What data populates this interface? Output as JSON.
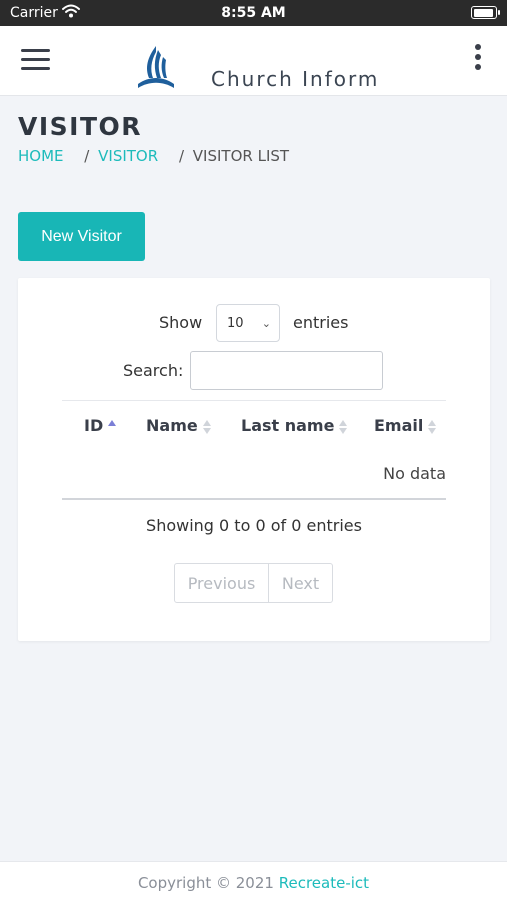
{
  "status_bar": {
    "carrier": "Carrier",
    "time": "8:55 AM",
    "battery_level": 0.95
  },
  "header": {
    "brand": "Church Inform",
    "menu_icon": "hamburger-icon",
    "more_icon": "kebab-icon",
    "logo_icon": "church-flame-logo"
  },
  "page": {
    "title": "VISITOR",
    "breadcrumb": {
      "home": "HOME",
      "section": "VISITOR",
      "current": "VISITOR LIST",
      "separator": "/"
    },
    "new_button": "New Visitor"
  },
  "table": {
    "show_label": "Show",
    "page_size": "10",
    "entries_label": "entries",
    "search_label": "Search:",
    "search_value": "",
    "columns": [
      "ID",
      "Name",
      "Last name",
      "Email"
    ],
    "sorted_column": "ID",
    "empty_text": "No data",
    "info": "Showing 0 to 0 of 0 entries",
    "previous": "Previous",
    "next": "Next"
  },
  "footer": {
    "text": "Copyright © 2021",
    "link": "Recreate-ict"
  },
  "colors": {
    "accent": "#18b6b6",
    "status_bar": "#2b2b2b",
    "background": "#f2f4f8",
    "sort_active": "#7b7fd6"
  }
}
